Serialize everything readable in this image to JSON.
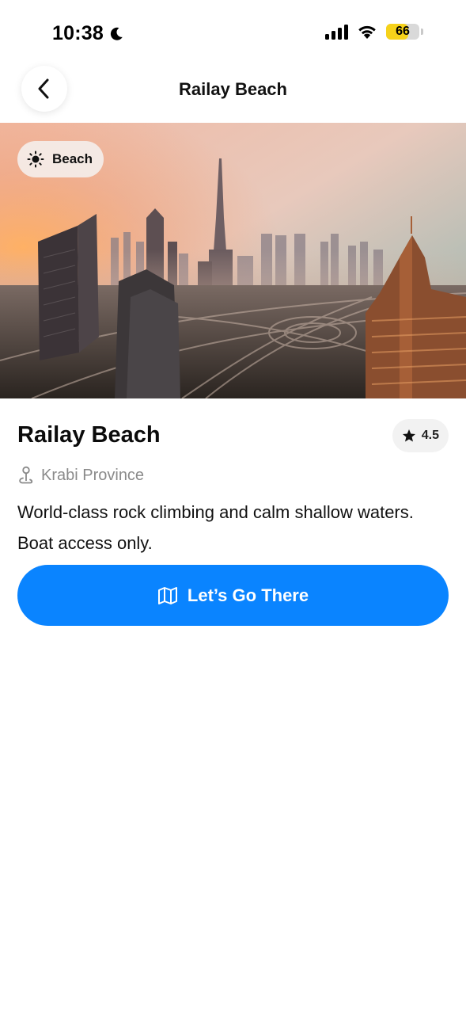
{
  "status_bar": {
    "time": "10:38",
    "battery_level": "66",
    "battery_fraction": 0.66,
    "icons": [
      "moon-icon",
      "signal-icon",
      "wifi-icon",
      "battery-icon"
    ]
  },
  "header": {
    "title": "Railay Beach",
    "back_icon": "chevron-left-icon"
  },
  "hero": {
    "category_label": "Beach",
    "category_icon": "sun-icon"
  },
  "place": {
    "name": "Railay Beach",
    "rating": "4.5",
    "rating_icon": "star-icon",
    "location": "Krabi Province",
    "location_icon": "map-pin-icon",
    "description": "World-class rock climbing and calm shallow waters. Boat access only."
  },
  "cta": {
    "label": "Let’s Go There",
    "icon": "map-icon",
    "color": "#0a84ff"
  }
}
